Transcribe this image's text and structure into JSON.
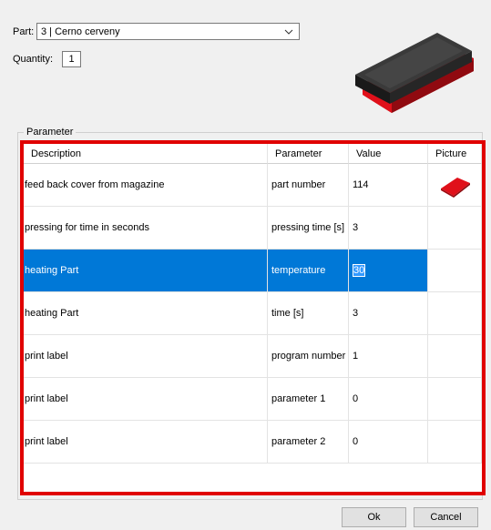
{
  "part": {
    "label": "Part:",
    "value": "3 | Cerno cerveny"
  },
  "quantity": {
    "label": "Quantity:",
    "value": "1"
  },
  "group_title": "Parameter",
  "columns": [
    "Description",
    "Parameter",
    "Value",
    "Picture"
  ],
  "rows": [
    {
      "description": "feed back cover from magazine",
      "parameter": "part number",
      "value": "114",
      "picture": "red-part-icon"
    },
    {
      "description": "pressing for time in seconds",
      "parameter": "pressing time [s]",
      "value": "3",
      "picture": ""
    },
    {
      "description": "heating Part",
      "parameter": "temperature",
      "value": "30",
      "picture": "",
      "selected": true
    },
    {
      "description": "heating Part",
      "parameter": "time [s]",
      "value": "3",
      "picture": ""
    },
    {
      "description": "print label",
      "parameter": "program number",
      "value": "1",
      "picture": ""
    },
    {
      "description": "print label",
      "parameter": "parameter 1",
      "value": "0",
      "picture": ""
    },
    {
      "description": "print label",
      "parameter": "parameter 2",
      "value": "0",
      "picture": ""
    }
  ],
  "buttons": {
    "ok": "Ok",
    "cancel": "Cancel"
  },
  "colors": {
    "selection": "#0078d7",
    "highlight_border": "#e00000",
    "part_red": "#e0101a"
  },
  "icons": {
    "combo": "chevron-down-icon",
    "preview": "part-3d-preview"
  }
}
